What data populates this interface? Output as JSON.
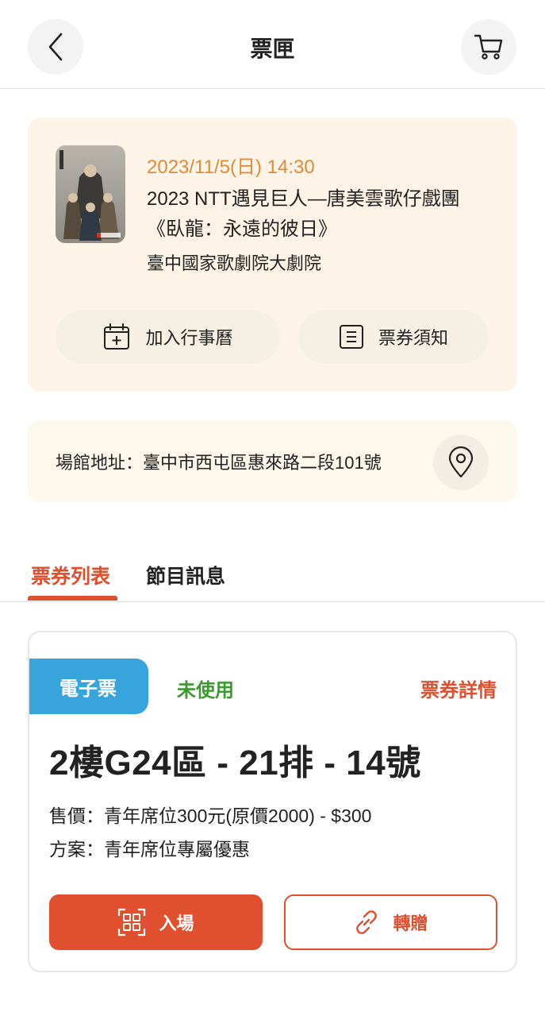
{
  "header": {
    "title": "票匣",
    "back_icon": "chevron-left-icon",
    "cart_icon": "cart-icon"
  },
  "event": {
    "date": "2023/11/5(日) 14:30",
    "title": "2023 NTT遇見巨人—唐美雲歌仔戲團《臥龍：永遠的彼日》",
    "venue": "臺中國家歌劇院大劇院",
    "calendar_button": "加入行事曆",
    "notice_button": "票券須知"
  },
  "address": {
    "text": "場館地址：臺中市西屯區惠來路二段101號"
  },
  "tabs": [
    {
      "label": "票券列表",
      "active": true
    },
    {
      "label": "節目訊息",
      "active": false
    }
  ],
  "ticket": {
    "type_badge": "電子票",
    "status": "未使用",
    "details_link": "票券詳情",
    "seat": "2樓G24區 - 21排 - 14號",
    "price": "售價：青年席位300元(原價2000) - $300",
    "plan": "方案：青年席位專屬優惠",
    "enter_button": "入場",
    "transfer_button": "轉贈"
  },
  "colors": {
    "accent": "#e0502f",
    "date": "#e08a3c",
    "status_green": "#3a9a2e",
    "badge_blue": "#38a4dc",
    "card_bg": "#fdf4e7"
  }
}
